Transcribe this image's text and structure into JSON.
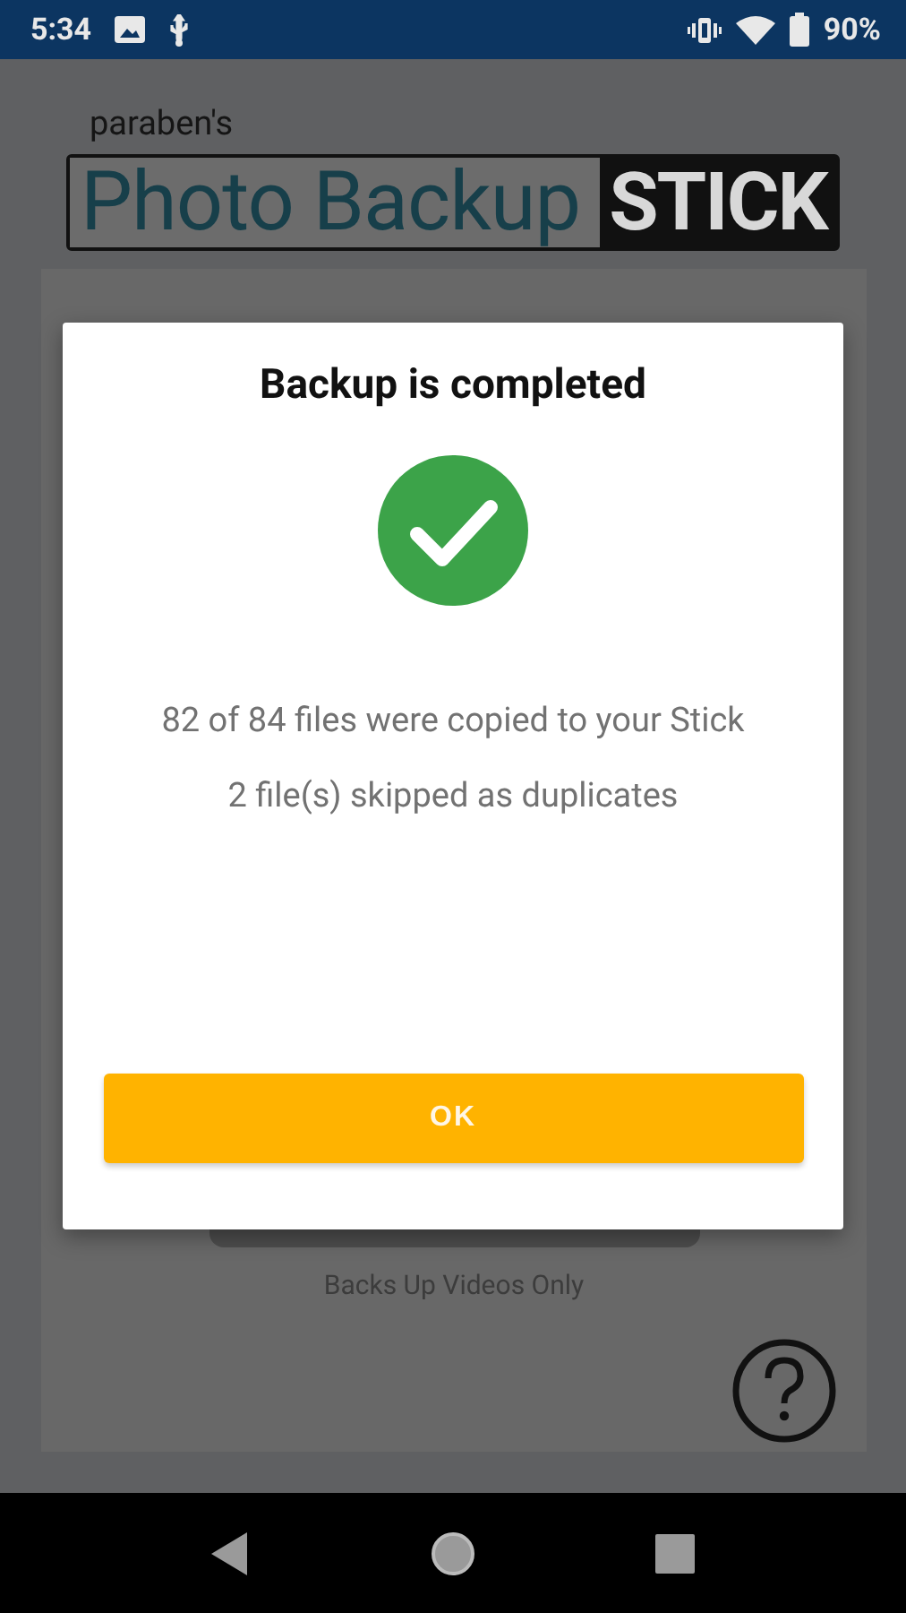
{
  "status_bar": {
    "time": "5:34",
    "battery": "90%"
  },
  "logo": {
    "brand": "paraben's",
    "title": "Photo Backup",
    "badge": "STICK"
  },
  "screen": {
    "caption": "Backs Up Videos Only"
  },
  "dialog": {
    "title": "Backup is completed",
    "lines": [
      "82 of 84 files were copied to your Stick",
      "2 file(s) skipped as duplicates"
    ],
    "button": "OK"
  }
}
